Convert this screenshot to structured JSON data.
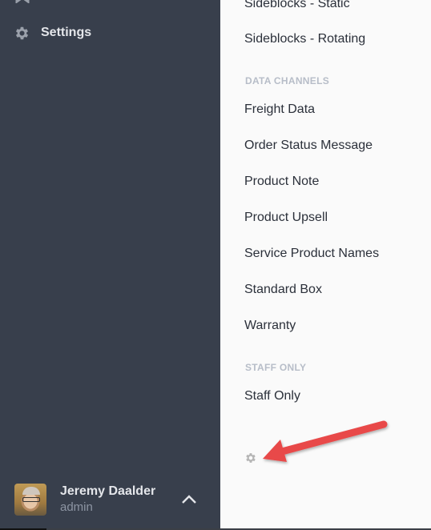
{
  "sidebar": {
    "nav": [
      {
        "label": "Settings",
        "icon": "gear-icon"
      }
    ],
    "user": {
      "name": "Jeremy Daalder",
      "role": "admin",
      "menu_icon": "chevron-up-icon"
    }
  },
  "content": {
    "items_top": [
      "Sideblocks - Static",
      "Sideblocks - Rotating"
    ],
    "sections": [
      {
        "title": "DATA CHANNELS",
        "items": [
          "Freight Data",
          "Order Status Message",
          "Product Note",
          "Product Upsell",
          "Service Product Names",
          "Standard Box",
          "Warranty"
        ]
      },
      {
        "title": "STAFF ONLY",
        "items": [
          "Staff Only"
        ]
      }
    ],
    "footer_icon": "gear-icon"
  },
  "annotation": {
    "type": "arrow",
    "color": "#e84a4a",
    "points_to": "settings-gear-button"
  }
}
